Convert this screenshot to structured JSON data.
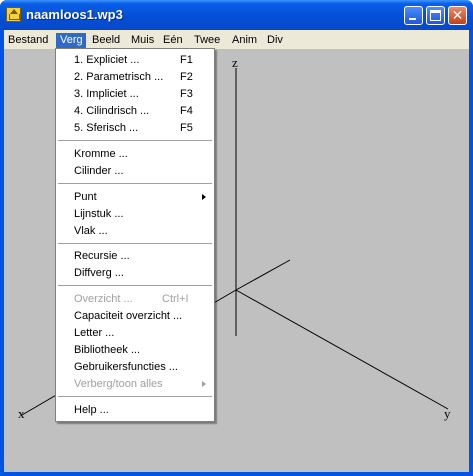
{
  "window": {
    "title": "naamloos1.wp3"
  },
  "title_buttons": {
    "minimize": "minimize-icon",
    "maximize": "maximize-icon",
    "close": "✕"
  },
  "menubar": [
    "Bestand",
    "Verg",
    "Beeld",
    "Muis",
    "Eén",
    "Twee",
    "Anim",
    "Div"
  ],
  "active_menu": "Verg",
  "dropdown": {
    "g1": [
      {
        "label": "1. Expliciet ...",
        "shortcut": "F1"
      },
      {
        "label": "2. Parametrisch ...",
        "shortcut": "F2"
      },
      {
        "label": "3. Impliciet ...",
        "shortcut": "F3"
      },
      {
        "label": "4. Cilindrisch ...",
        "shortcut": "F4"
      },
      {
        "label": "5. Sferisch ...",
        "shortcut": "F5"
      }
    ],
    "g2": [
      "Kromme ...",
      "Cilinder ..."
    ],
    "g3": [
      "Punt",
      "Lijnstuk ...",
      "Vlak ..."
    ],
    "g4": [
      "Recursie ...",
      "Diffverg ..."
    ],
    "g5": [
      {
        "label": "Overzicht ...",
        "shortcut": "Ctrl+I",
        "disabled": true
      },
      {
        "label": "Capaciteit overzicht ..."
      },
      {
        "label": "Letter ..."
      },
      {
        "label": "Bibliotheek ..."
      },
      {
        "label": "Gebruikersfuncties ..."
      },
      {
        "label": "Verberg/toon alles",
        "disabled": true
      }
    ],
    "g6": [
      "Help ..."
    ]
  },
  "axes": {
    "x": "x",
    "y": "y",
    "z": "z"
  },
  "colors": {
    "canvas": "#c0c0c0",
    "menu_highlight": "#316ac5",
    "titlebar": "#0054e3"
  }
}
